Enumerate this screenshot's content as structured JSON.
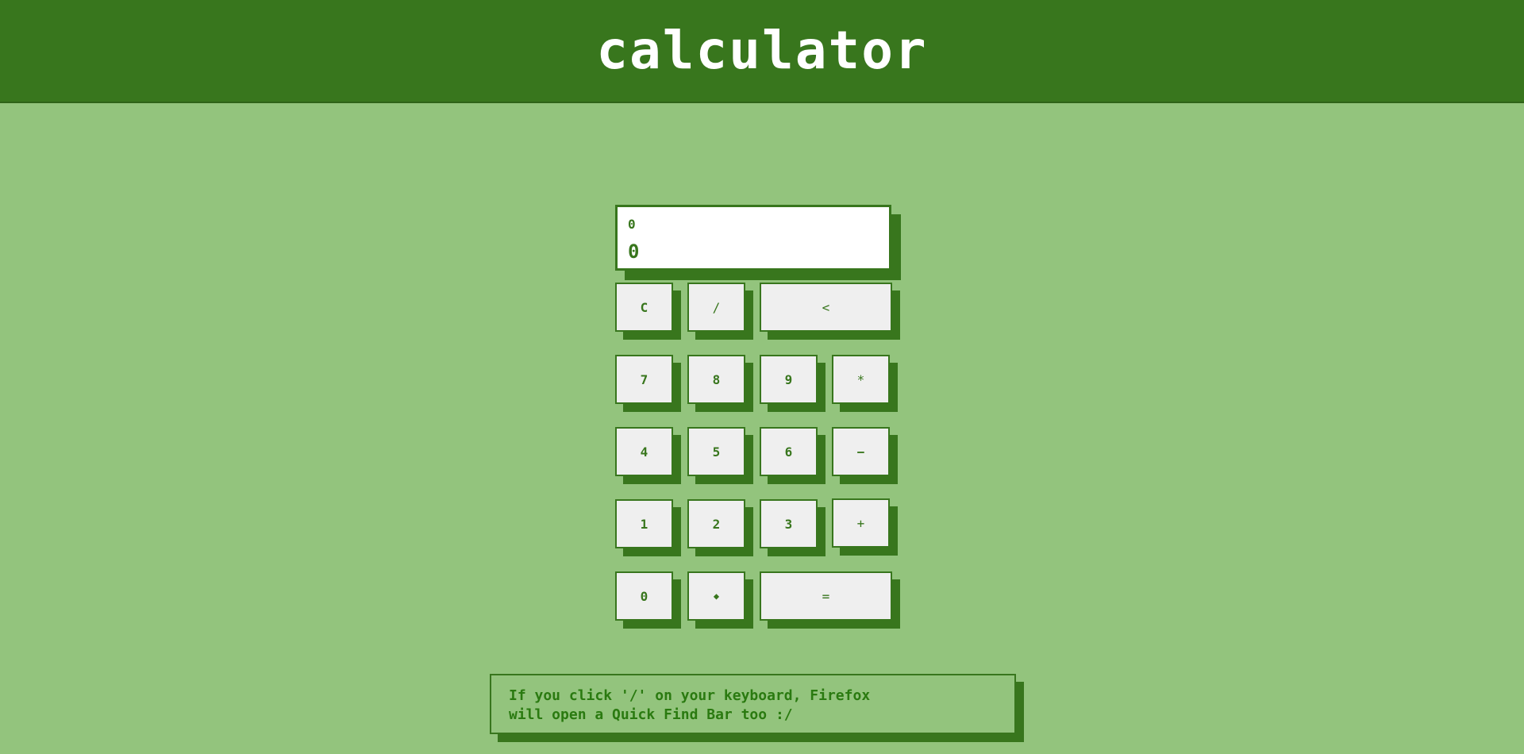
{
  "header": {
    "title": "calculator"
  },
  "display": {
    "previous": "0",
    "current": "0"
  },
  "keys": {
    "clear": "C",
    "divide": "/",
    "backspace": "<",
    "seven": "7",
    "eight": "8",
    "nine": "9",
    "multiply": "*",
    "four": "4",
    "five": "5",
    "six": "6",
    "subtract": "−",
    "one": "1",
    "two": "2",
    "three": "3",
    "add": "+",
    "zero": "0",
    "decimal": "◆",
    "equals": "="
  },
  "note": {
    "line1": "If you click '/' on your keyboard, Firefox",
    "line2": "will open a Quick Find Bar too :/"
  },
  "colors": {
    "background": "#93c47d",
    "header": "#38761d",
    "key_face": "#efefef",
    "display_face": "#ffffff"
  }
}
